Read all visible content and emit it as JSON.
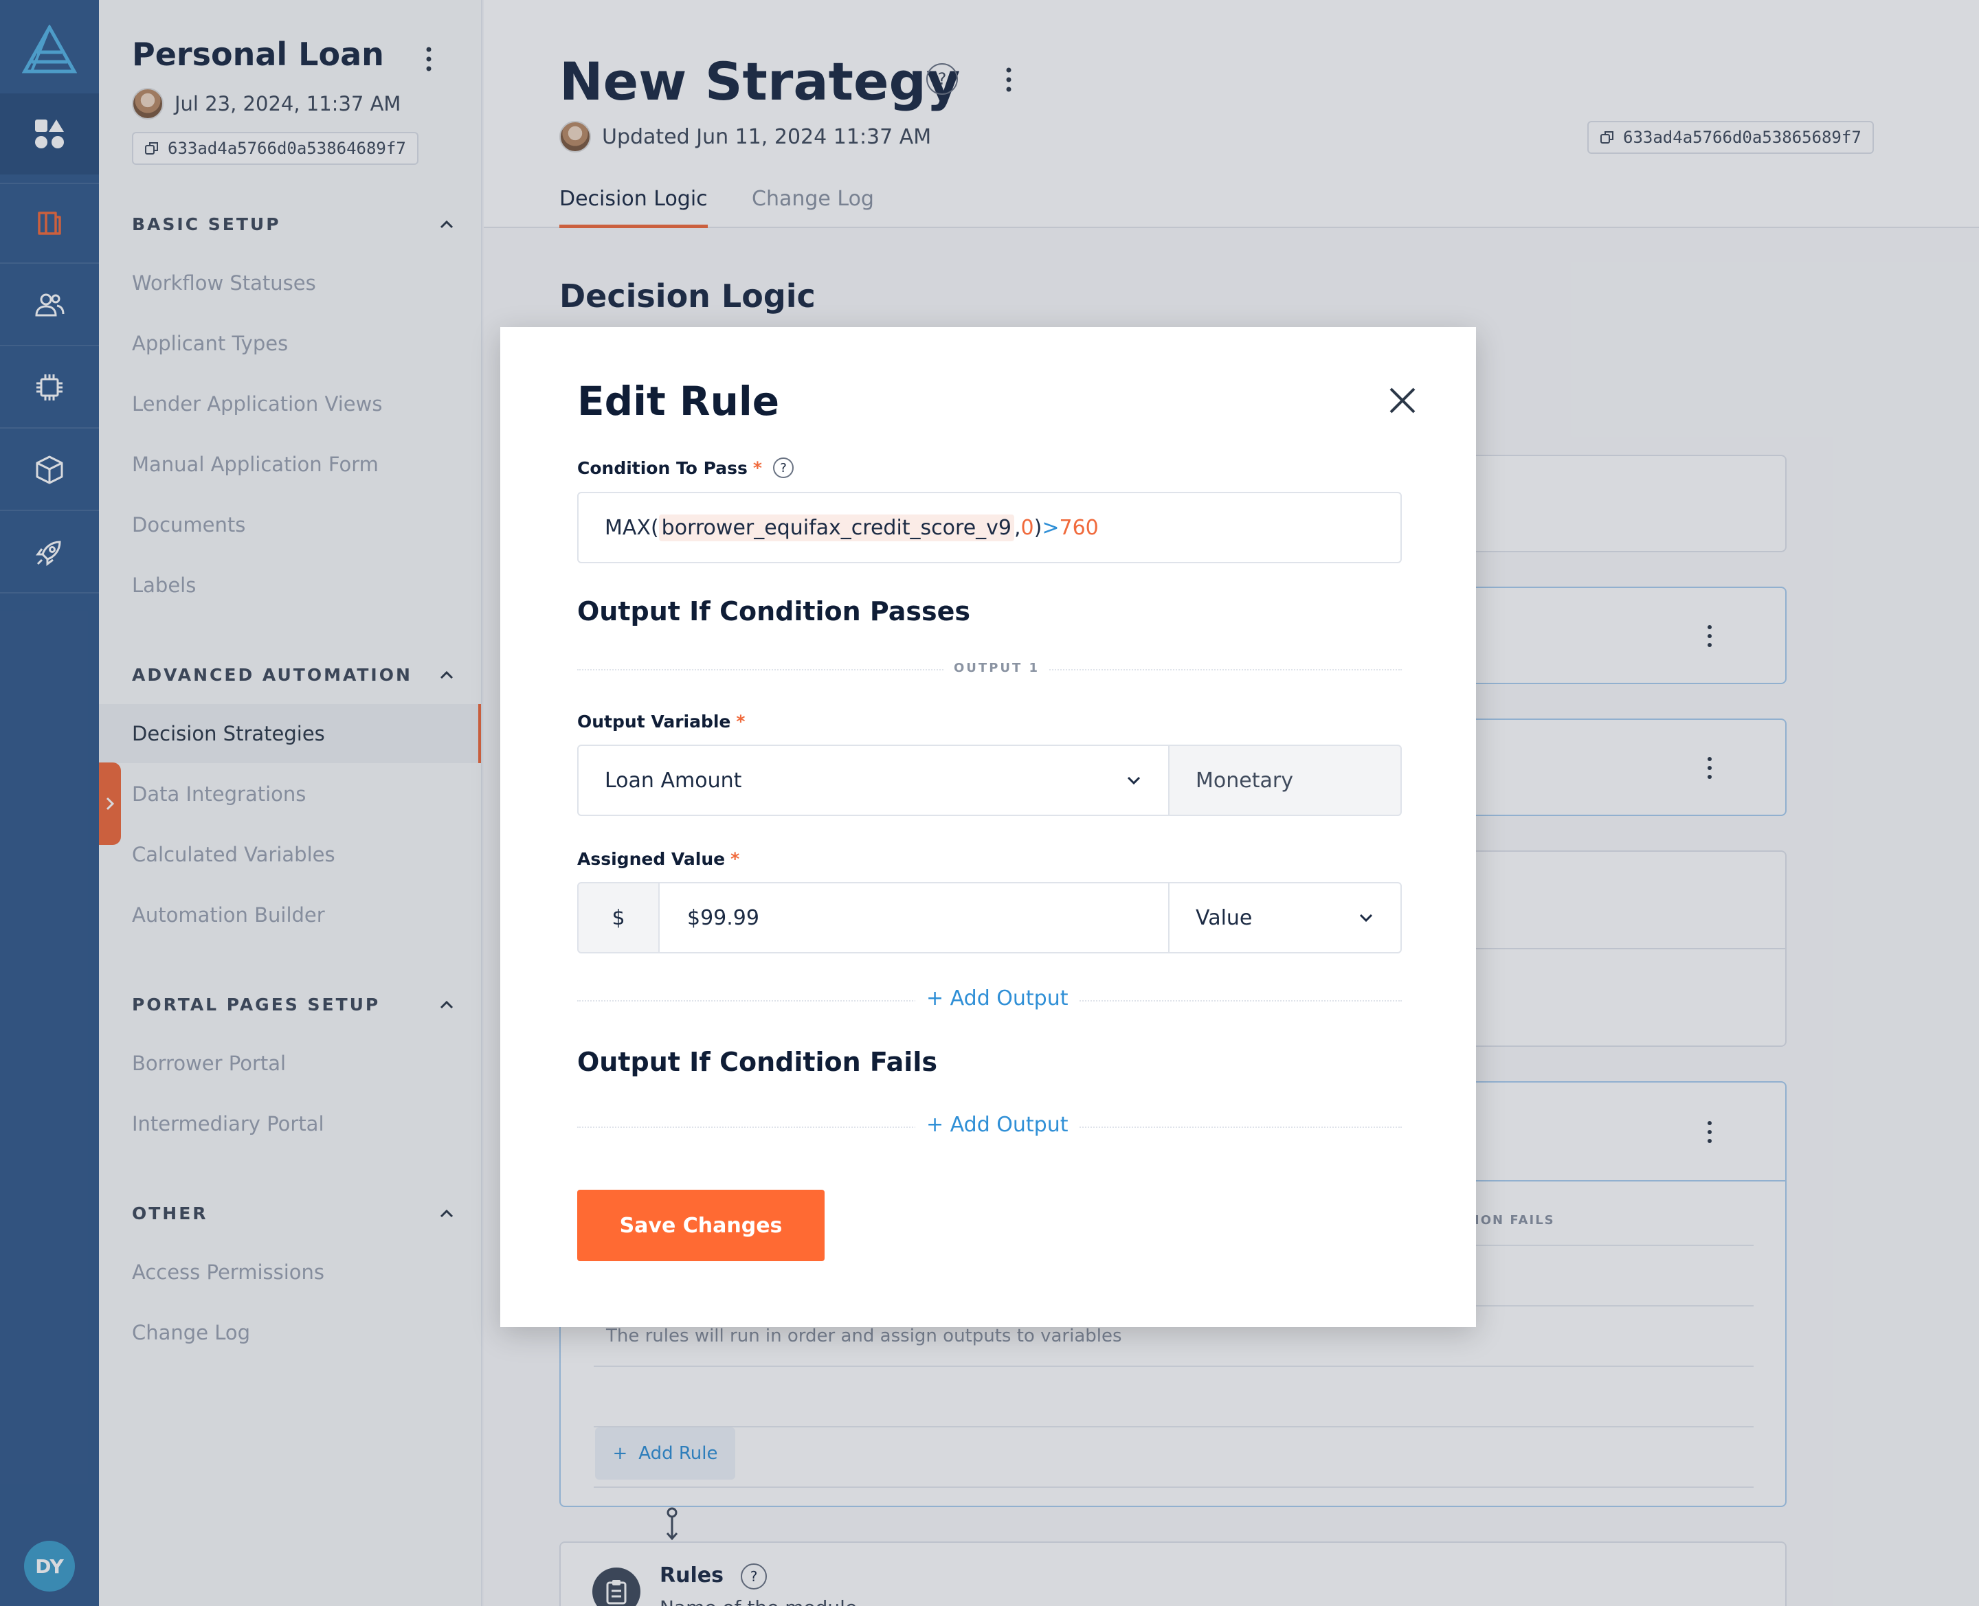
{
  "rail": {
    "items": [
      "logo",
      "apps-icon",
      "loans-icon",
      "users-icon",
      "chip-icon",
      "box-icon",
      "rocket-icon"
    ],
    "avatar_initials": "DY"
  },
  "sidebar": {
    "title": "Personal Loan",
    "date": "Jul 23, 2024, 11:37 AM",
    "id": "633ad4a5766d0a53864689f7",
    "sections": [
      {
        "label": "BASIC SETUP",
        "items": [
          "Workflow Statuses",
          "Applicant Types",
          "Lender Application Views",
          "Manual Application Form",
          "Documents",
          "Labels"
        ]
      },
      {
        "label": "ADVANCED AUTOMATION",
        "items": [
          "Decision Strategies",
          "Data Integrations",
          "Calculated Variables",
          "Automation Builder"
        ]
      },
      {
        "label": "PORTAL PAGES SETUP",
        "items": [
          "Borrower Portal",
          "Intermediary Portal"
        ]
      },
      {
        "label": "OTHER",
        "items": [
          "Access Permissions",
          "Change Log"
        ]
      }
    ],
    "active_item": "Decision Strategies"
  },
  "main": {
    "title": "New Strategy",
    "help": "?",
    "updated": "Updated Jun 11, 2024 11:37 AM",
    "id": "633ad4a5766d0a53865689f7",
    "tabs": [
      "Decision Logic",
      "Change Log"
    ],
    "section_title": "Decision Logic",
    "bg_partial_label": "ION FAILS",
    "bg_rules_hint": "The rules will run in order and assign outputs to variables",
    "bg_add_rule": "Add Rule",
    "bg_module_title": "Rules",
    "bg_module_sub": "Name of the module"
  },
  "modal": {
    "title": "Edit Rule",
    "condition_label": "Condition To Pass",
    "condition": {
      "prefix": "MAX(",
      "variable": "borrower_equifax_credit_score_v9",
      "comma": ",",
      "arg": "0",
      "close": ")",
      "op": ">",
      "value": "760"
    },
    "pass_heading": "Output If Condition Passes",
    "output_divider": "OUTPUT 1",
    "output_variable_label": "Output Variable",
    "output_variable": "Loan Amount",
    "output_type": "Monetary",
    "assigned_value_label": "Assigned Value",
    "currency_symbol": "$",
    "assigned_value": "$99.99",
    "value_mode": "Value",
    "add_output": "+ Add Output",
    "fail_heading": "Output If Condition Fails",
    "add_output_fail": "+ Add Output",
    "save_label": "Save Changes"
  },
  "colors": {
    "accent": "#ff6a33",
    "link": "#2f8fd6",
    "rail": "#335a8c",
    "required": "#f06a3c"
  }
}
